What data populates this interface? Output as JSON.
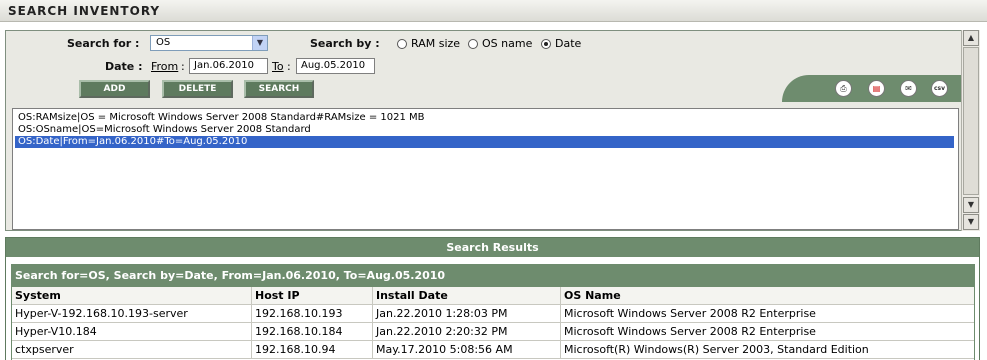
{
  "window": {
    "title": "SEARCH INVENTORY"
  },
  "search": {
    "search_for_label": "Search for :",
    "search_for_value": "OS",
    "search_by_label": "Search by :",
    "options": [
      "RAM size",
      "OS name",
      "Date"
    ],
    "selected_option": "Date",
    "date_label": "Date :",
    "from_label": "From",
    "from_value": "Jan.06.2010",
    "to_label": "To",
    "to_value": "Aug.05.2010"
  },
  "buttons": {
    "add": "ADD",
    "delete": "DELETE",
    "search": "SEARCH"
  },
  "toolbar_icons": [
    "print-icon",
    "pdf-icon",
    "email-icon",
    "csv-icon"
  ],
  "toolbar_icon_text": {
    "csv": "csv"
  },
  "criteria": [
    "OS:RAMsize|OS = Microsoft Windows Server 2008 Standard#RAMsize = 1021 MB",
    "OS:OSname|OS=Microsoft Windows Server 2008 Standard",
    "OS:Date|From=Jan.06.2010#To=Aug.05.2010"
  ],
  "selected_criterion_index": 2,
  "results": {
    "title": "Search Results",
    "summary": "Search for=OS, Search by=Date, From=Jan.06.2010, To=Aug.05.2010",
    "columns": [
      "System",
      "Host IP",
      "Install Date",
      "OS Name"
    ],
    "rows": [
      [
        "Hyper-V-192.168.10.193-server",
        "192.168.10.193",
        "Jan.22.2010 1:28:03 PM",
        "Microsoft Windows Server 2008 R2 Enterprise"
      ],
      [
        "Hyper-V10.184",
        "192.168.10.184",
        "Jan.22.2010 2:20:32 PM",
        "Microsoft Windows Server 2008 R2 Enterprise"
      ],
      [
        "ctxpserver",
        "192.168.10.94",
        "May.17.2010 5:08:56 AM",
        "Microsoft(R) Windows(R) Server 2003, Standard Edition"
      ]
    ]
  },
  "colors": {
    "accent": "#6e8c6e",
    "selection": "#3464c8",
    "panel": "#e9e9e3"
  }
}
